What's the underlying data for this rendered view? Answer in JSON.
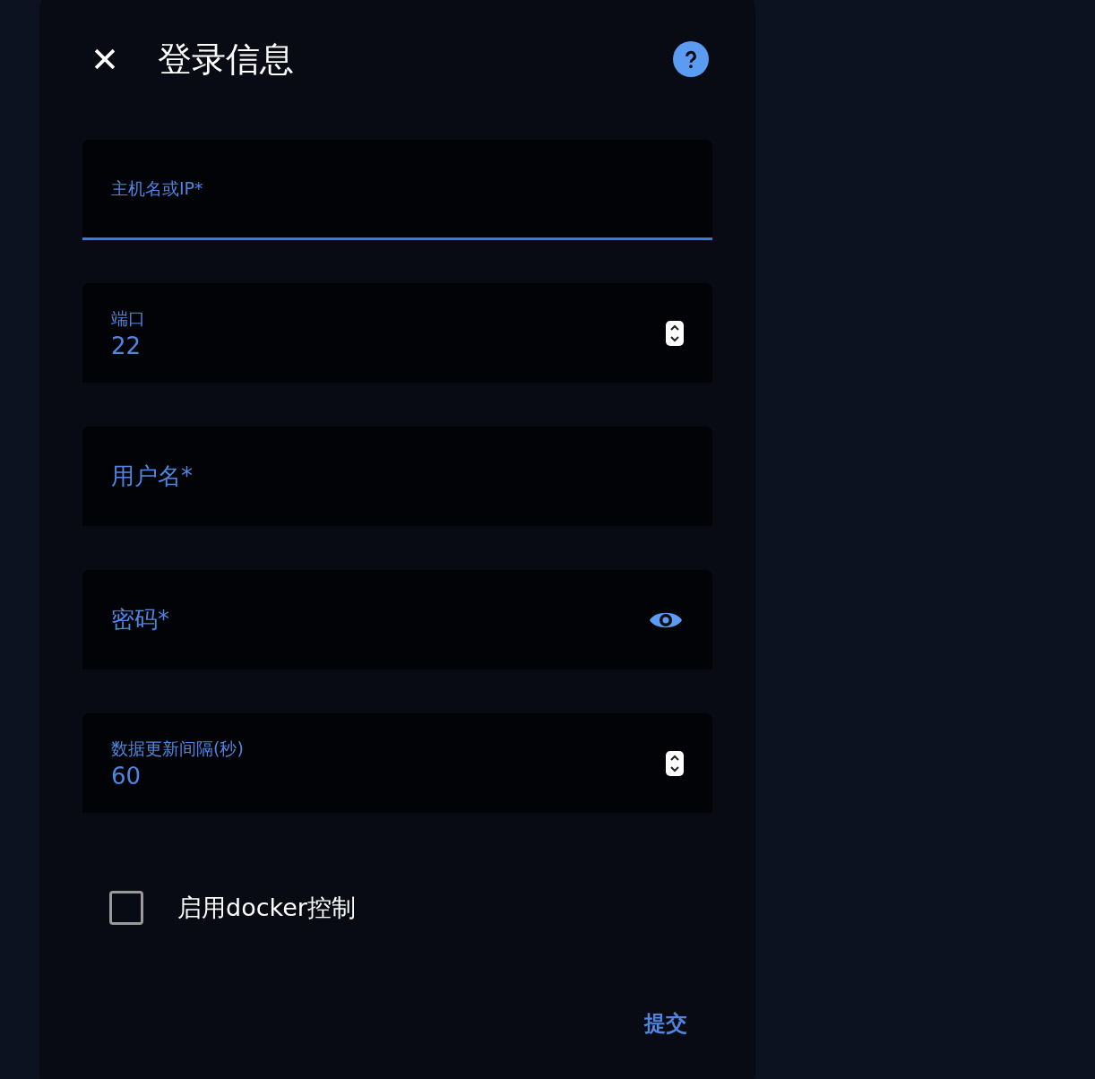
{
  "dialog": {
    "title": "登录信息"
  },
  "fields": [
    {
      "kind": "text",
      "label": "主机名或IP*",
      "focused": true
    },
    {
      "kind": "number",
      "label": "端口",
      "value": "22",
      "focused": false
    },
    {
      "kind": "text",
      "label": "用户名*",
      "focused": false
    },
    {
      "kind": "password",
      "label": "密码*",
      "focused": false
    },
    {
      "kind": "number",
      "label": "数据更新间隔(秒)",
      "value": "60",
      "focused": false
    }
  ],
  "checkbox": {
    "label": "启用docker控制",
    "checked": false
  },
  "submit": "提交"
}
